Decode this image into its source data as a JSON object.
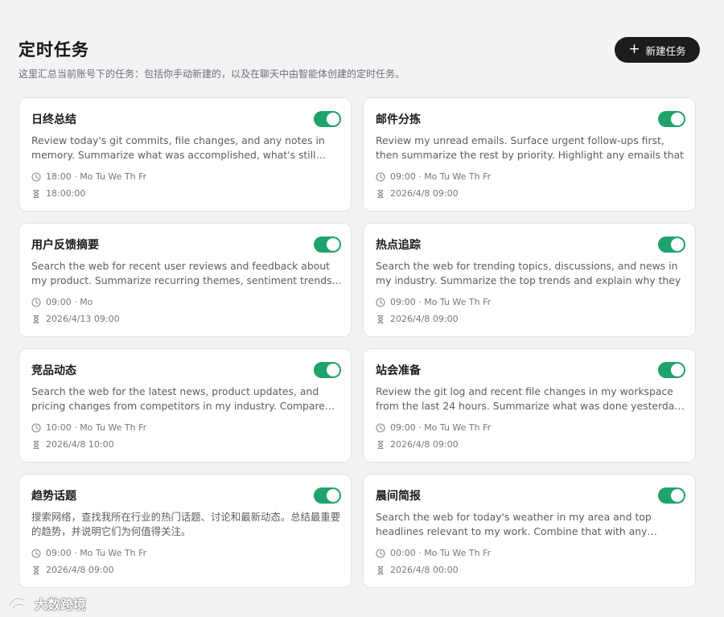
{
  "page": {
    "title": "定时任务",
    "subtitle": "这里汇总当前账号下的任务：包括你手动新建的，以及在聊天中由智能体创建的定时任务。",
    "new_button_label": "新建任务"
  },
  "colors": {
    "toggle_on": "#1fa36b",
    "button_bg": "#1c1c1f",
    "card_bg": "#ffffff",
    "page_bg": "#f3f3f5"
  },
  "tasks": [
    {
      "title": "日终总结",
      "enabled": true,
      "description": "Review today's git commits, file changes, and any notes in memory. Summarize what was accomplished, what's still pending, and what to pick up tomorrow.",
      "schedule": "18:00 · Mo Tu We Th Fr",
      "next_run": "18:00:00"
    },
    {
      "title": "邮件分拣",
      "enabled": true,
      "description": "Review my unread emails. Surface urgent follow-ups first, then summarize the rest by priority. Highlight any emails that",
      "schedule": "09:00 · Mo Tu We Th Fr",
      "next_run": "2026/4/8 09:00"
    },
    {
      "title": "用户反馈摘要",
      "enabled": true,
      "description": "Search the web for recent user reviews and feedback about my product. Summarize recurring themes, sentiment trends, and",
      "schedule": "09:00 · Mo",
      "next_run": "2026/4/13 09:00"
    },
    {
      "title": "热点追踪",
      "enabled": true,
      "description": "Search the web for trending topics, discussions, and news in my industry. Summarize the top trends and explain why they",
      "schedule": "09:00 · Mo Tu We Th Fr",
      "next_run": "2026/4/8 09:00"
    },
    {
      "title": "竞品动态",
      "enabled": true,
      "description": "Search the web for the latest news, product updates, and pricing changes from competitors in my industry. Compare them with my offering.",
      "schedule": "10:00 · Mo Tu We Th Fr",
      "next_run": "2026/4/8 10:00"
    },
    {
      "title": "站会准备",
      "enabled": true,
      "description": "Review the git log and recent file changes in my workspace from the last 24 hours. Summarize what was done yesterday, what's planned today.",
      "schedule": "09:00 · Mo Tu We Th Fr",
      "next_run": "2026/4/8 09:00"
    },
    {
      "title": "趋势话题",
      "enabled": true,
      "description": "搜索网络，查找我所在行业的热门话题、讨论和最新动态。总结最重要的趋势，并说明它们为何值得关注。",
      "schedule": "09:00 · Mo Tu We Th Fr",
      "next_run": "2026/4/8 09:00"
    },
    {
      "title": "晨间简报",
      "enabled": true,
      "description": "Search the web for today's weather in my area and top headlines relevant to my work. Combine that with any pending items.",
      "schedule": "00:00 · Mo Tu We Th Fr",
      "next_run": "2026/4/8 00:00"
    }
  ],
  "watermark": {
    "text": "大数跨境"
  }
}
